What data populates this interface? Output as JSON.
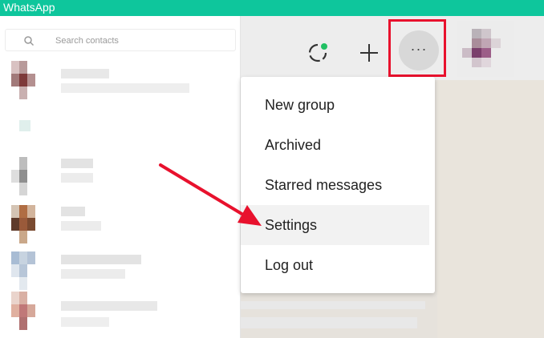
{
  "app": {
    "title": "WhatsApp"
  },
  "search": {
    "placeholder": "Search contacts",
    "icon": "search-icon"
  },
  "header": {
    "status_icon": "status-ring-icon",
    "new_chat_icon": "plus-icon",
    "menu_icon": "more-options-icon"
  },
  "menu": {
    "items": [
      {
        "label": "New group"
      },
      {
        "label": "Archived"
      },
      {
        "label": "Starred messages"
      },
      {
        "label": "Settings",
        "active": true
      },
      {
        "label": "Log out"
      }
    ]
  },
  "colors": {
    "titlebar": "#0ec69c",
    "highlight": "#e8112d",
    "status_dot": "#21c063"
  }
}
